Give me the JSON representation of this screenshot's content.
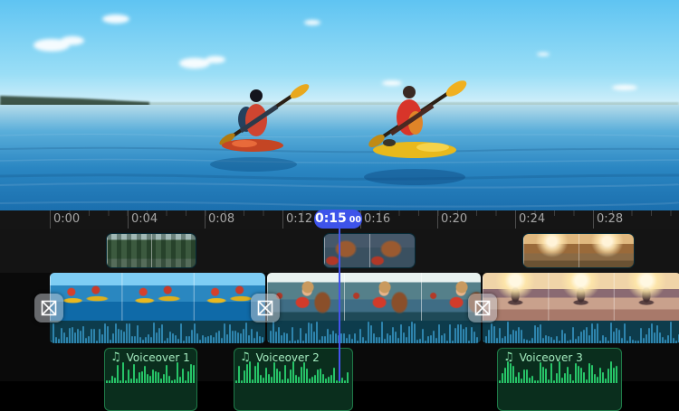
{
  "preview": {
    "label": "video-preview"
  },
  "ruler": {
    "labels": [
      "0:00",
      "0:04",
      "0:08",
      "0:12",
      "0:16",
      "0:20",
      "0:24",
      "0:28"
    ]
  },
  "playhead": {
    "time": "0:15",
    "frames": "00"
  },
  "voice": {
    "icon": "♫",
    "clips": [
      {
        "label": "Voiceover 1"
      },
      {
        "label": "Voiceover 2"
      },
      {
        "label": "Voiceover 3"
      }
    ]
  },
  "icons": {
    "transition": "crossfade-transition"
  },
  "colors": {
    "playhead_accent": "#3d53ea",
    "voice_green": "#27c468",
    "voice_bg": "#0a2e1d",
    "main_wave": "#2e84ad",
    "main_wave_bg": "#0d3c4c",
    "ruler_bg": "#151515",
    "ruler_text": "#a6a6a6"
  }
}
